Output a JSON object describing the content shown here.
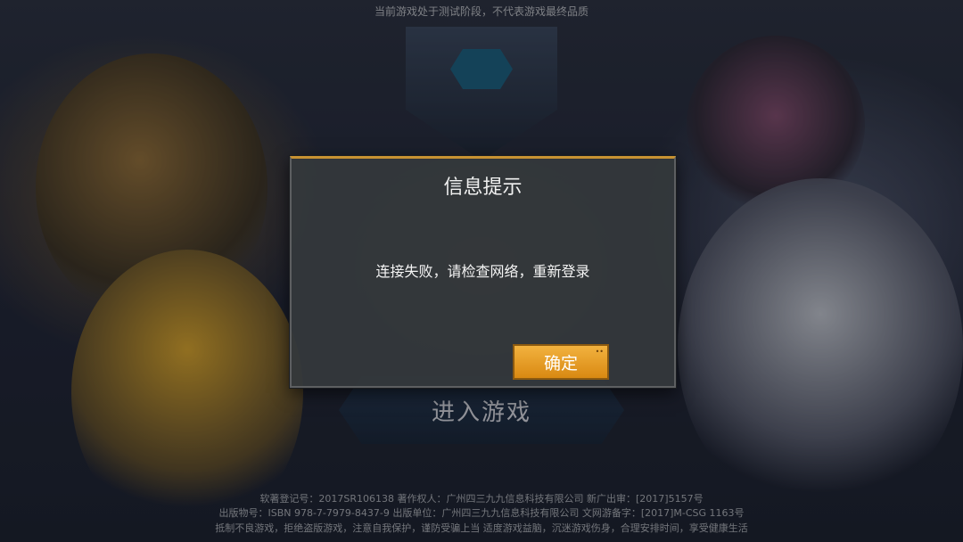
{
  "top_notice": "当前游戏处于测试阶段，不代表游戏最终品质",
  "enter_game_label": "进入游戏",
  "modal": {
    "title": "信息提示",
    "message": "连接失败，请检查网络，重新登录",
    "confirm_label": "确定"
  },
  "footer": {
    "line1": "软著登记号：2017SR106138 著作权人：广州四三九九信息科技有限公司 新广出审：[2017]5157号",
    "line2": "出版物号：ISBN 978-7-7979-8437-9 出版单位：广州四三九九信息科技有限公司 文网游备字：[2017]M-CSG 1163号",
    "line3": "抵制不良游戏，拒绝盗版游戏，注意自我保护，谨防受骗上当 适度游戏益脑，沉迷游戏伤身，合理安排时间，享受健康生活"
  },
  "colors": {
    "accent": "#f2b23f",
    "modal_bg": "#34383c",
    "modal_border_top": "#c89232"
  }
}
